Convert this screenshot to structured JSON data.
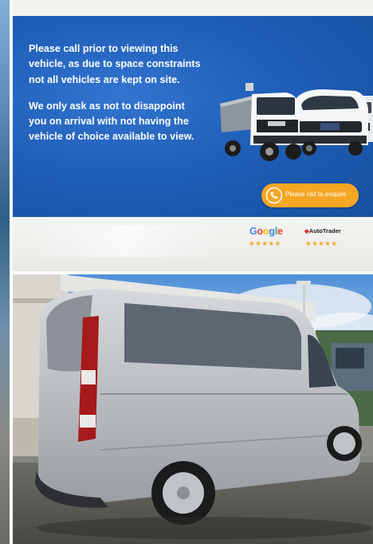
{
  "banner": {
    "paragraph1": "Please call prior to viewing this vehicle, as due to space constraints not all vehicles are kept on site.",
    "paragraph2": "We only ask as not to disappoint you on arrival with not having the vehicle of choice available to view.",
    "call_button_label": "Please call to enquire",
    "background_color": "#1f5fb8",
    "button_color": "#f5a623"
  },
  "ratings": {
    "google_label": "Google",
    "google_stars": "★★★★★",
    "autotrader_label": "AutoTrader",
    "autotrader_stars": "★★★★★"
  },
  "photo": {
    "subject": "silver-van-photo"
  },
  "icons": [
    "phone-icon",
    "trucks-illustration",
    "google-logo",
    "autotrader-logo"
  ]
}
